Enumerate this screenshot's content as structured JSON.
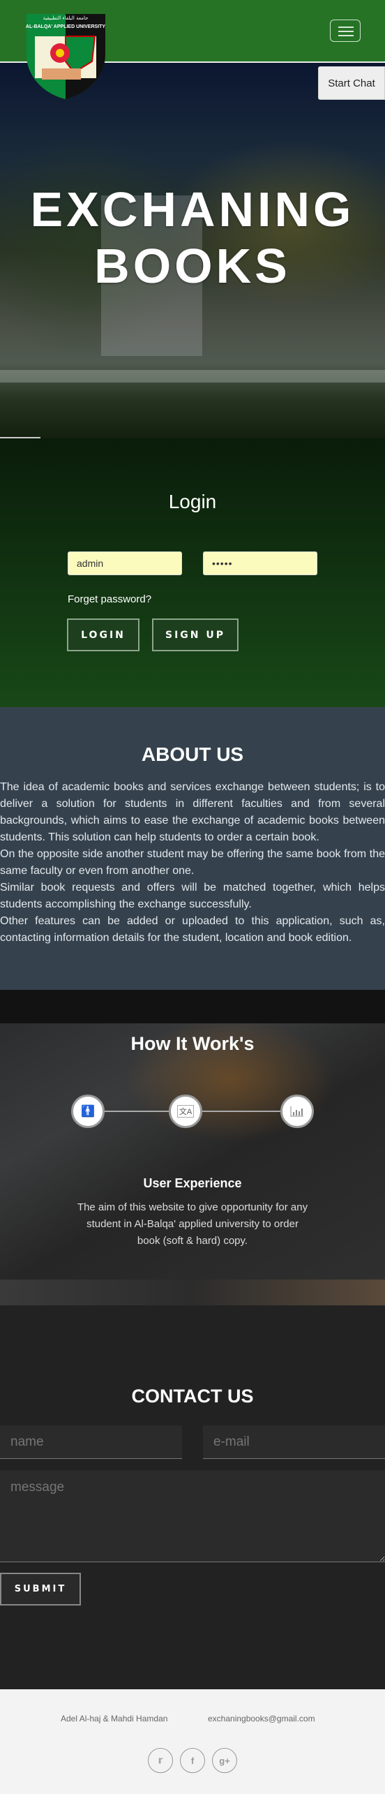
{
  "header": {
    "logo_text": "AL-BALQA' APPLIED UNIVERSITY",
    "logo_arabic": "جامعة البلقاء التطبيقية",
    "menu_icon": "hamburger-icon",
    "start_chat": "Start Chat"
  },
  "hero": {
    "title_line1": "EXCHANING",
    "title_line2": "BOOKS"
  },
  "login": {
    "title": "Login",
    "username_value": "admin",
    "password_value": "•••••",
    "forget_password": "Forget password?",
    "login_button": "LOGIN",
    "signup_button": "SIGN UP"
  },
  "about": {
    "title": "ABOUT US",
    "paragraphs": [
      "The idea of academic books and services exchange between students; is to deliver a solution for students in different faculties and from several backgrounds, which aims to ease the exchange of academic books between students. This solution can help students to order a certain book.",
      "On the opposite side another student may be offering the same book from the same faculty or even from another one.",
      "Similar book requests and offers will be matched together, which helps students accomplishing the exchange successfully.",
      "Other features can be added or uploaded to this application, such as, contacting information details for the student, location and book edition."
    ]
  },
  "how": {
    "title": "How It Work's",
    "steps": [
      {
        "icon": "person-icon"
      },
      {
        "icon": "translate-icon"
      },
      {
        "icon": "bar-chart-icon"
      }
    ],
    "active_title": "User Experience",
    "active_text": "The aim of this website to give opportunity for any student in Al-Balqa' applied university to order book (soft & hard) copy."
  },
  "contact": {
    "title": "CONTACT US",
    "name_placeholder": "name",
    "email_placeholder": "e-mail",
    "message_placeholder": "message",
    "submit": "SUBMIT"
  },
  "footer": {
    "credits": "Adel Al-haj & Mahdi Hamdan",
    "email": "exchaningbooks@gmail.com",
    "social": [
      "twitter-icon",
      "facebook-icon",
      "google-plus-icon"
    ]
  },
  "colors": {
    "header": "#267326",
    "about_bg": "#35424e",
    "contact_bg": "#222222",
    "footer_bg": "#f3f3f3",
    "input_autofill": "#fbfbbe"
  }
}
